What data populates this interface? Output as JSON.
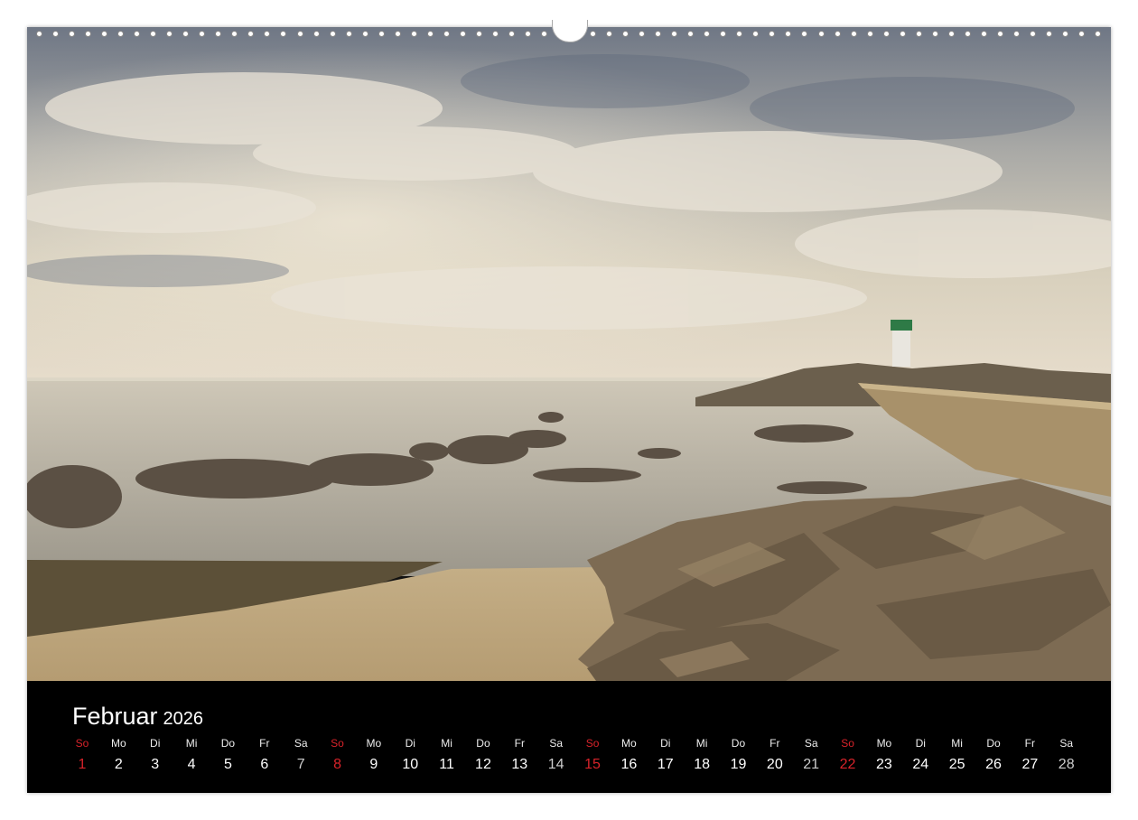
{
  "calendar": {
    "month": "Februar",
    "year": "2026",
    "days": [
      {
        "dow": "So",
        "num": "1"
      },
      {
        "dow": "Mo",
        "num": "2"
      },
      {
        "dow": "Di",
        "num": "3"
      },
      {
        "dow": "Mi",
        "num": "4"
      },
      {
        "dow": "Do",
        "num": "5"
      },
      {
        "dow": "Fr",
        "num": "6"
      },
      {
        "dow": "Sa",
        "num": "7"
      },
      {
        "dow": "So",
        "num": "8"
      },
      {
        "dow": "Mo",
        "num": "9"
      },
      {
        "dow": "Di",
        "num": "10"
      },
      {
        "dow": "Mi",
        "num": "11"
      },
      {
        "dow": "Do",
        "num": "12"
      },
      {
        "dow": "Fr",
        "num": "13"
      },
      {
        "dow": "Sa",
        "num": "14"
      },
      {
        "dow": "So",
        "num": "15"
      },
      {
        "dow": "Mo",
        "num": "16"
      },
      {
        "dow": "Di",
        "num": "17"
      },
      {
        "dow": "Mi",
        "num": "18"
      },
      {
        "dow": "Do",
        "num": "19"
      },
      {
        "dow": "Fr",
        "num": "20"
      },
      {
        "dow": "Sa",
        "num": "21"
      },
      {
        "dow": "So",
        "num": "22"
      },
      {
        "dow": "Mo",
        "num": "23"
      },
      {
        "dow": "Di",
        "num": "24"
      },
      {
        "dow": "Mi",
        "num": "25"
      },
      {
        "dow": "Do",
        "num": "26"
      },
      {
        "dow": "Fr",
        "num": "27"
      },
      {
        "dow": "Sa",
        "num": "28"
      }
    ]
  },
  "colors": {
    "sunday": "#d8232a",
    "calendar_background": "#000000"
  }
}
